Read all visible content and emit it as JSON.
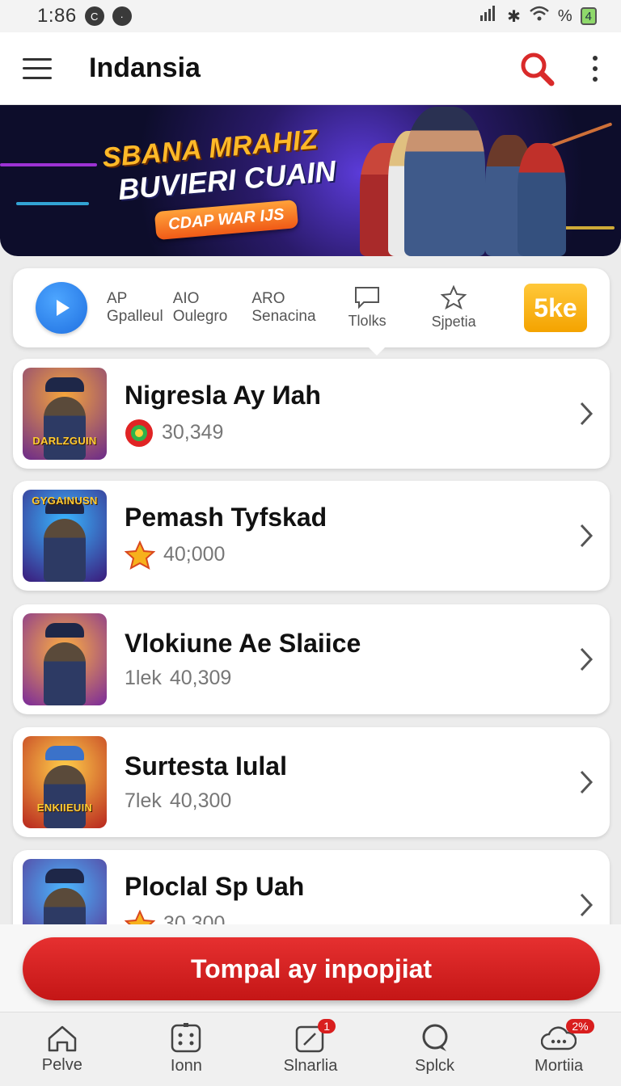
{
  "status": {
    "time": "1:86",
    "battery": "4"
  },
  "appbar": {
    "title": "Indansia"
  },
  "banner": {
    "line1": "SBANA MRAHIZ",
    "line2": "BUVIERI CUAIN",
    "button": "CDAP WAR IJS"
  },
  "quick": {
    "items": [
      {
        "top": "AP",
        "bottom": "Gpalleul"
      },
      {
        "top": "AIO",
        "bottom": "Oulegro"
      },
      {
        "top": "ARO",
        "bottom": "Senacina"
      }
    ],
    "icon_items": [
      {
        "label": "Tlolks",
        "icon": "chat-icon"
      },
      {
        "label": "Sjpetia",
        "icon": "star-outline-icon"
      }
    ],
    "badge": "5ke"
  },
  "list": [
    {
      "title": "Nigresla Ay Иah",
      "sub": "30,349",
      "prefix": "",
      "thumb_label": "DARLZGUIN",
      "icon": "red-chip-icon"
    },
    {
      "title": "Pemash Tyfskad",
      "sub": "40;000",
      "prefix": "",
      "thumb_label": "GYGAINUSN",
      "icon": "star-icon"
    },
    {
      "title": "Vlokiune Ae Slaiice",
      "sub": "40,309",
      "prefix": "1lek",
      "thumb_label": "",
      "icon": ""
    },
    {
      "title": "Surtesta Iulal",
      "sub": "40,300",
      "prefix": "7lek",
      "thumb_label": "ENKIIEUIN",
      "icon": ""
    },
    {
      "title": "Ploclal Sp Uah",
      "sub": "30,300",
      "prefix": "",
      "thumb_label": "",
      "icon": "star-icon"
    }
  ],
  "cta": {
    "label": "Tompal ay inpopjiat"
  },
  "nav": [
    {
      "label": "Pelve",
      "icon": "home-icon",
      "badge": ""
    },
    {
      "label": "Ionn",
      "icon": "dice-icon",
      "badge": ""
    },
    {
      "label": "Slnarlia",
      "icon": "edit-icon",
      "badge": "1"
    },
    {
      "label": "Splck",
      "icon": "chat-bubble-icon",
      "badge": ""
    },
    {
      "label": "Mortiia",
      "icon": "cloud-icon",
      "badge": "2%"
    }
  ]
}
